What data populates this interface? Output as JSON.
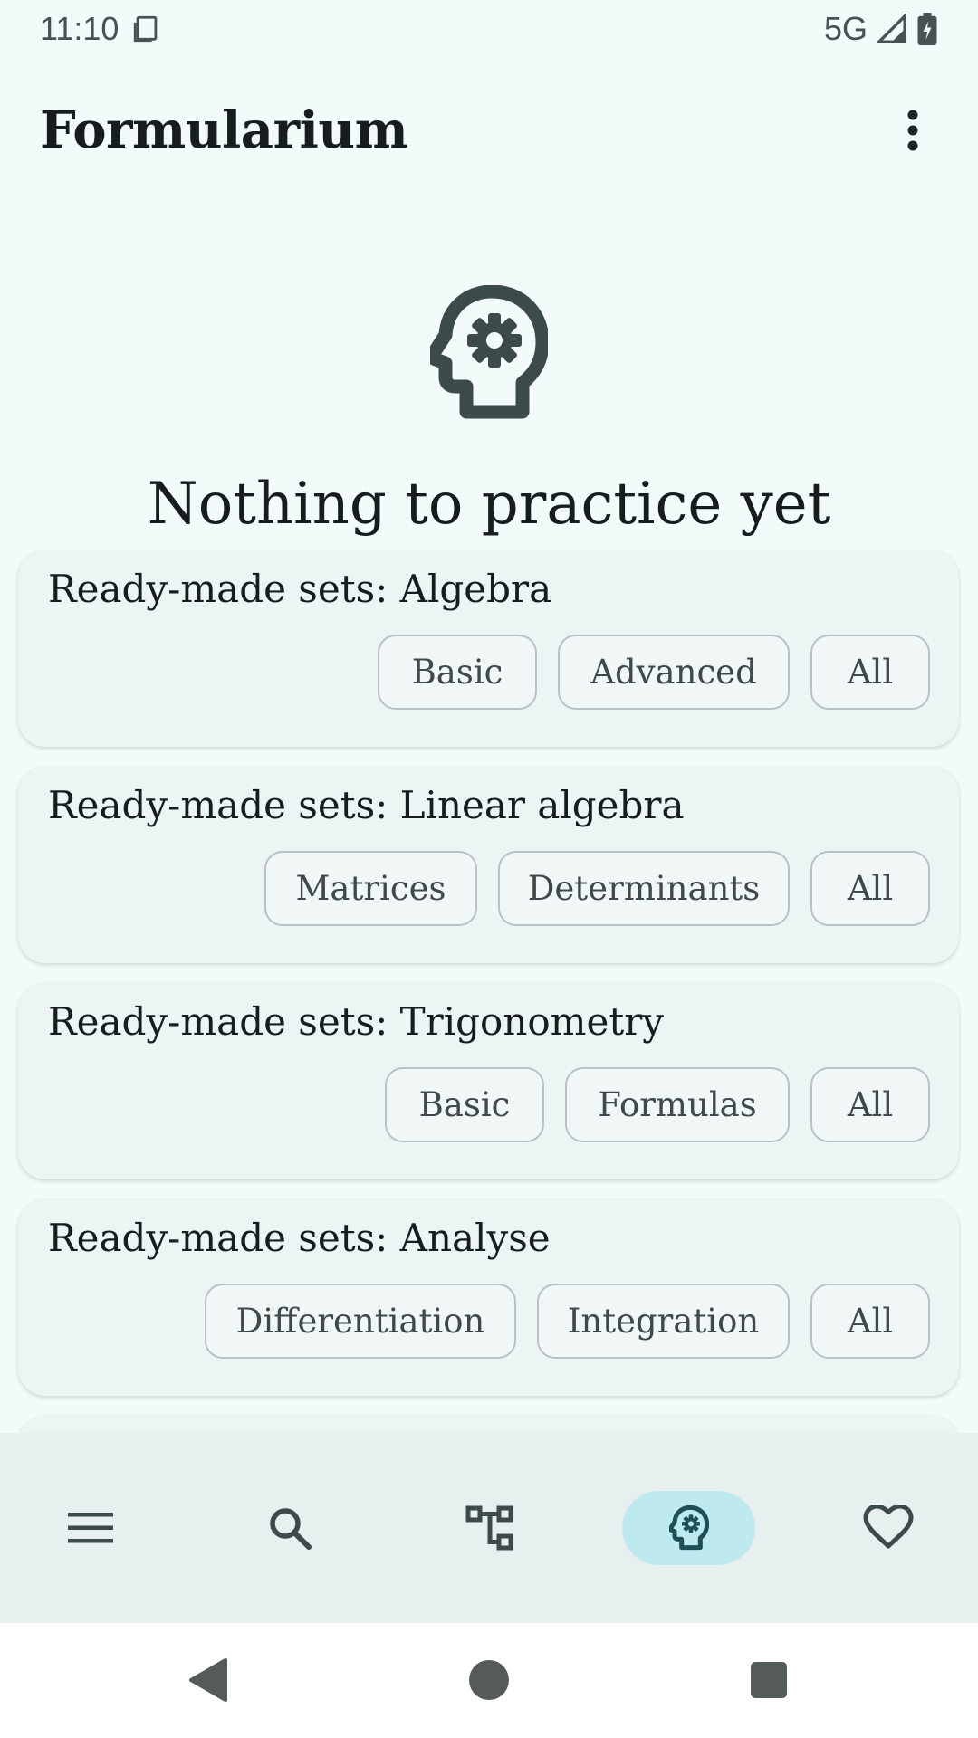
{
  "status_bar": {
    "time": "11:10",
    "network": "5G",
    "icons": [
      "sim-card-icon",
      "signal-icon",
      "battery-charging-icon"
    ]
  },
  "app_bar": {
    "title": "Formularium",
    "menu_icon": "more-vert-icon"
  },
  "empty_state": {
    "icon": "psychology-icon",
    "title": "Nothing to practice yet"
  },
  "sets": [
    {
      "title": "Ready-made sets: Algebra",
      "buttons": [
        "Basic",
        "Advanced",
        "All"
      ]
    },
    {
      "title": "Ready-made sets: Linear algebra",
      "buttons": [
        "Matrices",
        "Determinants",
        "All"
      ]
    },
    {
      "title": "Ready-made sets: Trigonometry",
      "buttons": [
        "Basic",
        "Formulas",
        "All"
      ]
    },
    {
      "title": "Ready-made sets: Analyse",
      "buttons": [
        "Differentiation",
        "Integration",
        "All"
      ]
    }
  ],
  "bottom_nav": {
    "items": [
      {
        "icon": "menu-icon",
        "active": false
      },
      {
        "icon": "search-icon",
        "active": false
      },
      {
        "icon": "tree-structure-icon",
        "active": false
      },
      {
        "icon": "psychology-icon",
        "active": true
      },
      {
        "icon": "heart-icon",
        "active": false
      }
    ]
  },
  "system_nav": {
    "icons": [
      "back-icon",
      "home-icon",
      "recents-icon"
    ]
  },
  "colors": {
    "background": "#f3fafa",
    "card": "#edf4f4",
    "active_nav": "#bde9ef",
    "icon": "#3c4a4c"
  }
}
